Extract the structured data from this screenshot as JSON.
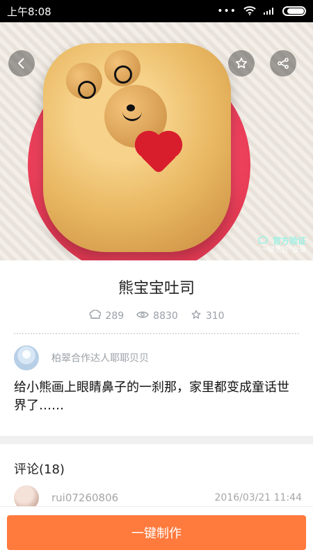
{
  "status_bar": {
    "time": "上午8:08",
    "icons": [
      "more-dots-icon",
      "wifi-icon",
      "signal-icon",
      "battery-icon"
    ]
  },
  "hero": {
    "watermark_main": "官方验证",
    "watermark_sub": "“一键烹饪”食谱"
  },
  "recipe": {
    "title": "熊宝宝吐司",
    "stats": {
      "made": "289",
      "views": "8830",
      "favorites": "310"
    },
    "author": "柏翠合作达人耶耶贝贝",
    "description": "给小熊画上眼睛鼻子的一刹那，家里都变成童话世界了……"
  },
  "comments": {
    "title": "评论(18)",
    "items": [
      {
        "user": "rui07260806",
        "time": "2016/03/21 11:44"
      }
    ]
  },
  "actions": {
    "primary": "一键制作"
  },
  "colors": {
    "accent": "#ff7a3d",
    "muted_text": "#9aa0a6",
    "plate_red": "#ff4d6d"
  }
}
